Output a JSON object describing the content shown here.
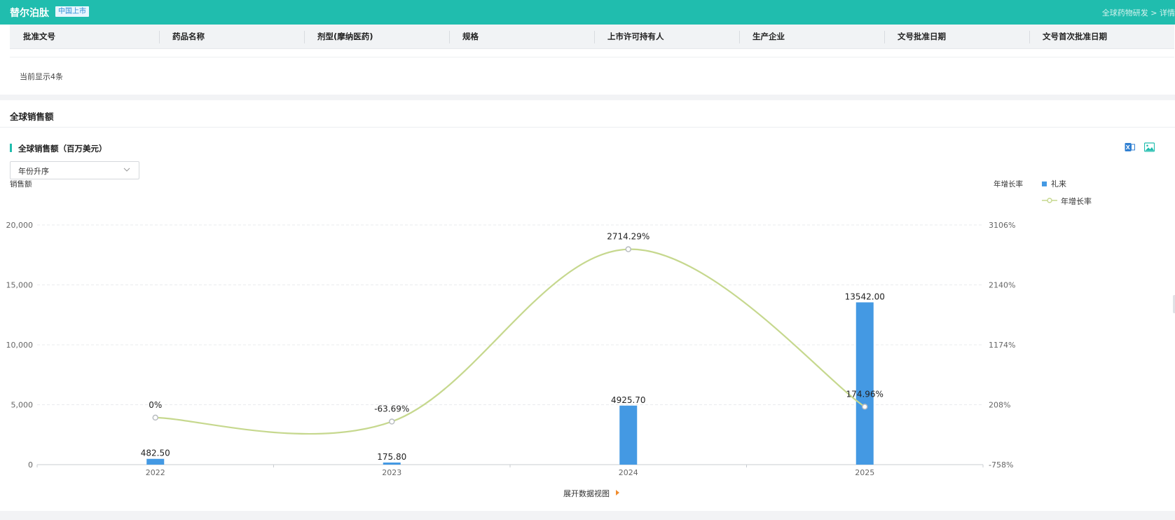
{
  "header": {
    "title": "替尔泊肽",
    "tag": "中国上市",
    "breadcrumb": "全球药物研发 > 详情"
  },
  "table": {
    "columns": [
      "批准文号",
      "药品名称",
      "剂型(摩纳医药)",
      "规格",
      "上市许可持有人",
      "生产企业",
      "文号批准日期",
      "文号首次批准日期"
    ],
    "count_text": "当前显示4条"
  },
  "section": {
    "title": "全球销售额",
    "chart_title": "全球销售额（百万美元）"
  },
  "sort": {
    "selected": "年份升序"
  },
  "expand_label": "展开数据视图",
  "colors": {
    "brand": "#20bdae",
    "bar": "#4499e3",
    "line": "#c6d88e"
  },
  "icons": {
    "export": "excel-export-icon",
    "download": "image-download-icon"
  },
  "chart_data": {
    "type": "bar",
    "categories": [
      "2022",
      "2023",
      "2024",
      "2025"
    ],
    "series": [
      {
        "name": "礼来",
        "type": "bar",
        "axis": "left",
        "values": [
          482.5,
          175.8,
          4925.7,
          13542.0
        ],
        "labels": [
          "482.50",
          "175.80",
          "4925.70",
          "13542.00"
        ]
      },
      {
        "name": "年增长率",
        "type": "line",
        "smooth": true,
        "axis": "right",
        "values": [
          0,
          -63.69,
          2714.29,
          174.96
        ],
        "labels": [
          "0%",
          "-63.69%",
          "2714.29%",
          "174.96%"
        ]
      }
    ],
    "ylabel": "销售额",
    "y2label": "年增长率",
    "ylim": [
      0,
      20000
    ],
    "y2lim": [
      -758,
      3106
    ],
    "yticks": [
      "0",
      "5,000",
      "10,000",
      "15,000",
      "20,000"
    ],
    "y2ticks": [
      "-758%",
      "208%",
      "1174%",
      "2140%",
      "3106%"
    ],
    "grid": true,
    "legend": "top-right"
  }
}
